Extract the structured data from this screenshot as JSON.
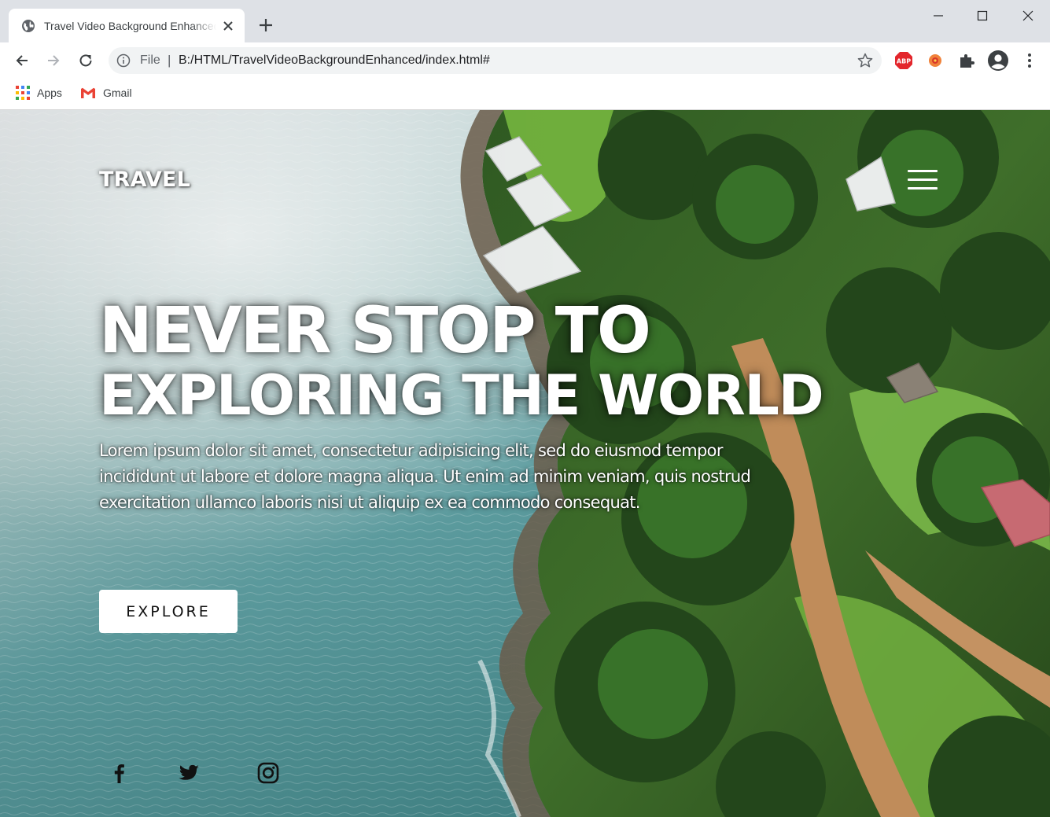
{
  "browser": {
    "tab_title": "Travel Video Background Enhanced",
    "omnibox": {
      "scheme_label": "File",
      "separator": "|",
      "url": "B:/HTML/TravelVideoBackgroundEnhanced/index.html#"
    },
    "extensions": {
      "adblock_label": "ABP"
    },
    "bookmarks": [
      {
        "label": "Apps",
        "icon": "apps-grid-icon"
      },
      {
        "label": "Gmail",
        "icon": "gmail-icon"
      }
    ]
  },
  "page": {
    "logo": "TRAVEL",
    "headline": {
      "line1": "NEVER STOP TO",
      "line2": "EXPLORING THE WORLD"
    },
    "body_text": "Lorem ipsum dolor sit amet, consectetur adipisicing elit, sed do eiusmod tempor incididunt ut labore et dolore magna aliqua. Ut enim ad minim veniam, quis nostrud exercitation ullamco laboris nisi ut aliquip ex ea commodo consequat.",
    "cta_label": "EXPLORE",
    "social_icons": [
      "facebook-icon",
      "twitter-icon",
      "instagram-icon"
    ]
  },
  "colors": {
    "tabstrip": "#dee1e6",
    "omnibox": "#f1f3f4",
    "text_on_hero": "#ffffff",
    "button_bg": "#ffffff",
    "button_text": "#111111"
  }
}
